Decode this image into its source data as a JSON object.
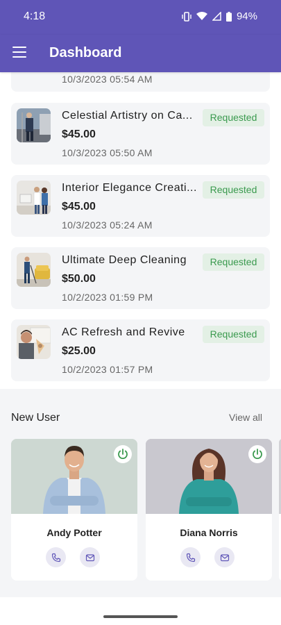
{
  "status_bar": {
    "time": "4:18",
    "battery": "94%",
    "icons": [
      "vibrate-icon",
      "wifi-icon",
      "signal-icon",
      "battery-icon"
    ]
  },
  "app_bar": {
    "title": "Dashboard",
    "menu_icon": "menu-icon"
  },
  "bookings": {
    "partial_item": {
      "date": "10/3/2023 05:54 AM"
    },
    "items": [
      {
        "name": "Celestial Artistry on Ca...",
        "price": "$45.00",
        "date": "10/3/2023 05:50 AM",
        "status": "Requested"
      },
      {
        "name": "Interior Elegance Creati...",
        "price": "$45.00",
        "date": "10/3/2023 05:24 AM",
        "status": "Requested"
      },
      {
        "name": "Ultimate Deep Cleaning",
        "price": "$50.00",
        "date": "10/2/2023 01:59 PM",
        "status": "Requested"
      },
      {
        "name": "AC Refresh and Revive",
        "price": "$25.00",
        "date": "10/2/2023 01:57 PM",
        "status": "Requested"
      }
    ]
  },
  "new_user": {
    "title": "New User",
    "view_all": "View all",
    "users": [
      {
        "name": "Andy Potter"
      },
      {
        "name": "Diana Norris"
      }
    ]
  },
  "colors": {
    "primary": "#5f55b7",
    "badge_bg": "#e3f0e5",
    "badge_text": "#3a9a4e",
    "card_bg": "#f4f5f7",
    "power_green": "#3a9a4e"
  }
}
